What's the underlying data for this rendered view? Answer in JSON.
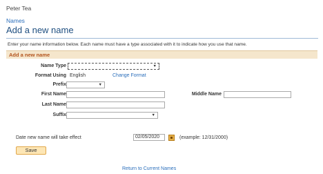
{
  "header": {
    "person_name": "Peter Tea",
    "breadcrumb": "Names",
    "page_title": "Add a new name"
  },
  "intro_text": "Enter your name information below. Each name must have a type associated with it to indicate how you use that name.",
  "section": {
    "title": "Add a new name"
  },
  "form": {
    "name_type_label": "Name Type",
    "name_type_value": "",
    "format_using_label": "Format Using",
    "format_using_value": "English",
    "change_format_link": "Change Format",
    "prefix_label": "Prefix",
    "prefix_value": "",
    "first_name_label": "First Name",
    "first_name_value": "",
    "middle_name_label": "Middle Name",
    "middle_name_value": "",
    "last_name_label": "Last Name",
    "last_name_value": "",
    "suffix_label": "Suffix",
    "suffix_value": "",
    "effective_date_label": "Date new name will take effect",
    "effective_date_value": "02/05/2020",
    "date_example": "(example: 12/31/2000)"
  },
  "actions": {
    "save_label": "Save",
    "return_link": "Return to Current Names"
  },
  "colors": {
    "link": "#2a6ebb",
    "title": "#1f4f80",
    "section_bg": "#f5e6cc",
    "section_title": "#b3541e",
    "button_bg": "#fde6b5"
  },
  "icons": {
    "dropdown": "chevron-down-icon",
    "calendar": "calendar-icon"
  }
}
